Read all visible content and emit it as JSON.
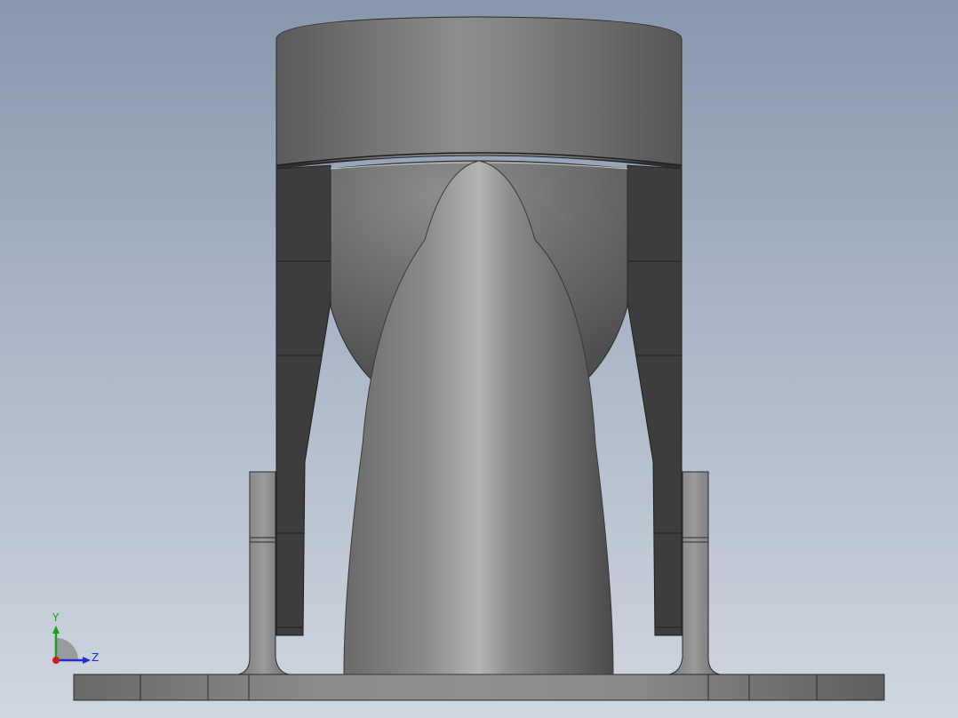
{
  "viewport": {
    "background_top": "#8897ad",
    "background_bottom": "#cfd6df"
  },
  "model": {
    "shade_dark": "#3c3c3c",
    "shade_mid": "#6e6e6e",
    "shade_light": "#a8a8a8",
    "edge_color": "#1e1e1e"
  },
  "triad": {
    "y_label": "Y",
    "z_label": "Z",
    "y_color": "#1aa01a",
    "z_color": "#1a2fd0",
    "x_color": "#d01a1a"
  }
}
